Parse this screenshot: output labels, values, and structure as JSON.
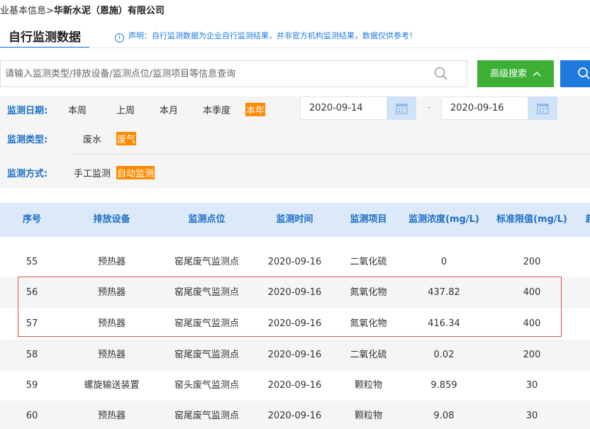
{
  "breadcrumb": {
    "prefix": "业基本信息>",
    "company": "华新水泥（恩施）有限公司"
  },
  "header": {
    "title": "自行监测数据",
    "notice_icon": "i",
    "notice": "声明：自行监测数据为企业自行监测结果，并非官方机构监测结果，数据仅供参考！"
  },
  "search": {
    "placeholder": "请输入监测类型/排放设备/监测点位/监测项目等信息查询",
    "value": "",
    "advanced_label": "高级搜索",
    "advanced_icon": "chevron-up-icon",
    "search_icon": "search-icon"
  },
  "filters": {
    "date": {
      "label": "监测日期:",
      "options": [
        "本周",
        "上周",
        "本月",
        "本季度",
        "本年"
      ],
      "active": "本年",
      "start": "2020-09-14",
      "end": "2020-09-16",
      "sep": "-"
    },
    "type": {
      "label": "监测类型:",
      "options": [
        "废水",
        "废气"
      ],
      "active": "废气"
    },
    "mode": {
      "label": "监测方式:",
      "options": [
        "手工监测",
        "自动监测"
      ],
      "active": "自动监测"
    }
  },
  "table": {
    "headers": [
      "序号",
      "排放设备",
      "监测点位",
      "监测时间",
      "监测项目",
      "监测浓度(mg/L)",
      "标准限值(mg/L)",
      "超"
    ],
    "rows": [
      {
        "no": "55",
        "device": "预热器",
        "point": "窑尾废气监测点",
        "time": "2020-09-16",
        "item": "二氧化硫",
        "conc": "0",
        "limit": "200"
      },
      {
        "no": "56",
        "device": "预热器",
        "point": "窑尾废气监测点",
        "time": "2020-09-16",
        "item": "氮氧化物",
        "conc": "437.82",
        "limit": "400"
      },
      {
        "no": "57",
        "device": "预热器",
        "point": "窑尾废气监测点",
        "time": "2020-09-16",
        "item": "氮氧化物",
        "conc": "416.34",
        "limit": "400"
      },
      {
        "no": "58",
        "device": "预热器",
        "point": "窑尾废气监测点",
        "time": "2020-09-16",
        "item": "二氧化硫",
        "conc": "0.02",
        "limit": "200"
      },
      {
        "no": "59",
        "device": "螺旋输送装置",
        "point": "窑头废气监测点",
        "time": "2020-09-16",
        "item": "颗粒物",
        "conc": "9.859",
        "limit": "30"
      },
      {
        "no": "60",
        "device": "预热器",
        "point": "窑尾废气监测点",
        "time": "2020-09-16",
        "item": "颗粒物",
        "conc": "9.08",
        "limit": "30"
      }
    ]
  },
  "colors": {
    "accent": "#1f7ae0",
    "active_filter": "#ff8a00",
    "advanced_btn": "#3cb035",
    "highlight": "#d9534f"
  }
}
